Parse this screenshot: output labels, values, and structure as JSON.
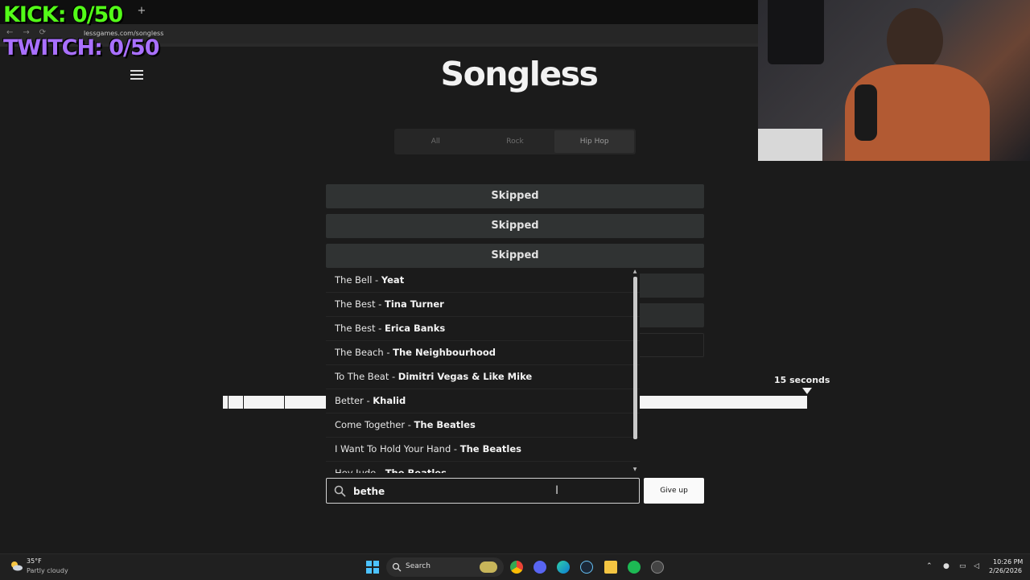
{
  "overlay": {
    "kick_counter": "KICK: 0/50",
    "twitch_counter": "TWITCH: 0/50"
  },
  "browser": {
    "new_tab": "+",
    "url": "lessgames.com/songless"
  },
  "app": {
    "logo": "Songless",
    "genres": [
      "All",
      "Rock",
      "Hip Hop"
    ],
    "active_genre": "Hip Hop",
    "guesses": [
      "Skipped",
      "Skipped",
      "Skipped"
    ],
    "timeline_label": "15 seconds"
  },
  "dropdown": {
    "items": [
      {
        "song": "The Bell - ",
        "artist": "Yeat"
      },
      {
        "song": "The Best - ",
        "artist": "Tina Turner"
      },
      {
        "song": "The Best - ",
        "artist": "Erica Banks"
      },
      {
        "song": "The Beach - ",
        "artist": "The Neighbourhood"
      },
      {
        "song": "To The Beat - ",
        "artist": "Dimitri Vegas & Like Mike"
      },
      {
        "song": "Better - ",
        "artist": "Khalid"
      },
      {
        "song": "Come Together - ",
        "artist": "The Beatles"
      },
      {
        "song": "I Want To Hold Your Hand - ",
        "artist": "The Beatles"
      },
      {
        "song": "Hey Jude - ",
        "artist": "The Beatles"
      }
    ]
  },
  "search": {
    "value": "bethe",
    "give_up": "Give up"
  },
  "taskbar": {
    "temp": "35°F",
    "condition": "Partly cloudy",
    "search_label": "Search",
    "time": "10:26 PM",
    "date": "2/26/2026"
  }
}
